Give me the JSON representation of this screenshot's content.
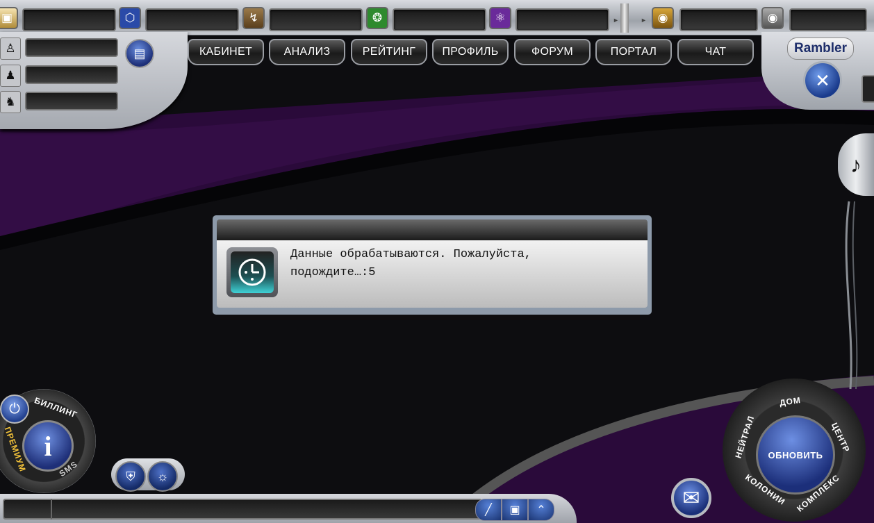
{
  "tabs": [
    "КАБИНЕТ",
    "АНАЛИЗ",
    "РЕЙТИНГ",
    "ПРОФИЛЬ",
    "ФОРУМ",
    "ПОРТАЛ",
    "ЧАТ"
  ],
  "brand": "Rambler",
  "resources": {
    "icons": [
      "cube-icon",
      "box-icon",
      "lightning-icon",
      "wheat-icon",
      "atom-icon",
      "coins-icon",
      "gold-icon"
    ]
  },
  "dialog": {
    "message": "Данные обрабатываются. Пожалуйста, подождите…:",
    "countdown": "5"
  },
  "left_dial": {
    "billing": "БИЛЛИНГ",
    "premium": "ПРЕМИУМ",
    "sms": "SMS",
    "info": "i"
  },
  "right_dial": {
    "refresh": "ОБНОВИТЬ",
    "home": "ДОМ",
    "center": "ЦЕНТР",
    "complex": "КОМПЛЕКС",
    "colonies": "КОЛОНИИ",
    "neutral": "НЕЙТРАЛ"
  },
  "colors": {
    "accent_blue": "#1e2f78",
    "panel_silver": "#c5c8cd",
    "background_purple": "#2a0a3a"
  }
}
